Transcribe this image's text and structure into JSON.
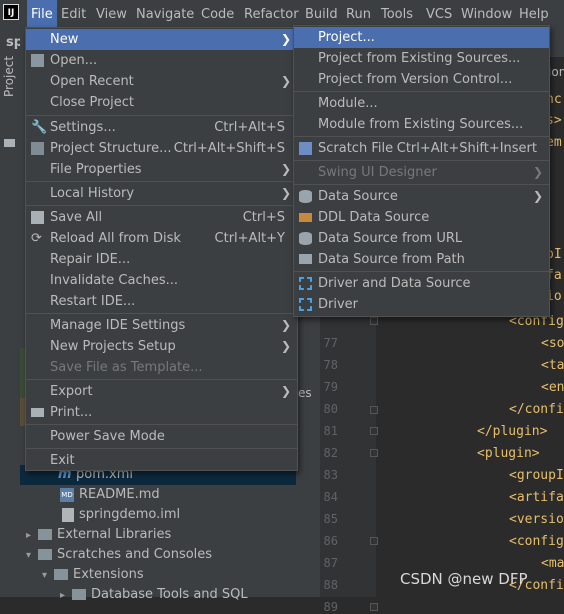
{
  "app_logo": "IJ",
  "menubar": [
    "File",
    "Edit",
    "View",
    "Navigate",
    "Code",
    "Refactor",
    "Build",
    "Run",
    "Tools",
    "VCS",
    "Window",
    "Help"
  ],
  "partial_tab": "spr",
  "tool_strip": {
    "project_label": "Project"
  },
  "file_menu": {
    "new": "New",
    "open": "Open...",
    "open_recent": "Open Recent",
    "close_project": "Close Project",
    "settings": "Settings...",
    "settings_sc": "Ctrl+Alt+S",
    "project_structure": "Project Structure...",
    "project_structure_sc": "Ctrl+Alt+Shift+S",
    "file_properties": "File Properties",
    "local_history": "Local History",
    "save_all": "Save All",
    "save_all_sc": "Ctrl+S",
    "reload": "Reload All from Disk",
    "reload_sc": "Ctrl+Alt+Y",
    "repair_ide": "Repair IDE...",
    "invalidate_caches": "Invalidate Caches...",
    "restart_ide": "Restart IDE...",
    "manage_ide_settings": "Manage IDE Settings",
    "new_projects_setup": "New Projects Setup",
    "save_as_template": "Save File as Template...",
    "export": "Export",
    "print": "Print...",
    "power_save": "Power Save Mode",
    "exit": "Exit"
  },
  "new_submenu": {
    "project": "Project...",
    "project_existing": "Project from Existing Sources...",
    "project_vcs": "Project from Version Control...",
    "module": "Module...",
    "module_existing": "Module from Existing Sources...",
    "scratch_file": "Scratch File",
    "scratch_file_sc": "Ctrl+Alt+Shift+Insert",
    "swing_ui": "Swing UI Designer",
    "data_source": "Data Source",
    "ddl_data_source": "DDL Data Source",
    "ds_from_url": "Data Source from URL",
    "ds_from_path": "Data Source from Path",
    "driver_and_ds": "Driver and Data Source",
    "driver": "Driver"
  },
  "project_tree": {
    "pom": "pom.xml",
    "readme": "README.md",
    "iml": "springdemo.iml",
    "external_libraries": "External Libraries",
    "scratches": "Scratches and Consoles",
    "extensions": "Extensions",
    "db_tools": "Database Tools and SQL",
    "partial_es": "es"
  },
  "editor": {
    "partial_ation": "ation",
    "line_numbers": [
      "77",
      "78",
      "79",
      "80",
      "81",
      "82",
      "83",
      "84",
      "85",
      "86",
      "87",
      "88",
      "89"
    ],
    "code_lines_top": [
      "nc",
      "s>",
      "em",
      "pI",
      "fa",
      "io"
    ],
    "code_lines": [
      "<config",
      "<so",
      "<ta",
      "<en",
      "</confi",
      "</plugin>",
      "<plugin>",
      "<groupI",
      "<artifa",
      "<versio",
      "<config",
      "<ma",
      "</confi"
    ]
  },
  "watermark": "CSDN @new DFP"
}
